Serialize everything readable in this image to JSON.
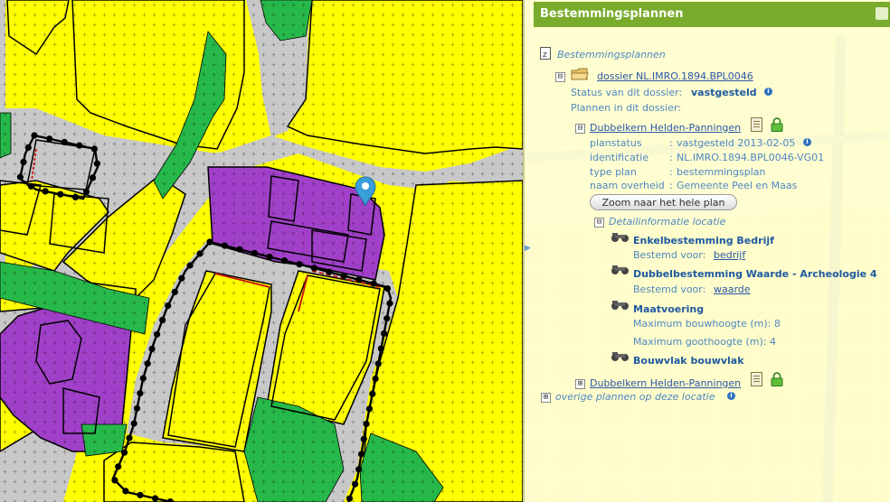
{
  "panel": {
    "title": "Bestemmingsplannen",
    "root_label": "Bestemmingsplannen",
    "dossier": {
      "link": "dossier NL.IMRO.1894.BPL0046",
      "status_label": "Status van dit dossier:",
      "status_value": "vastgesteld",
      "plans_label": "Plannen in dit dossier:"
    },
    "plan": {
      "name": "Dubbelkern Helden-Panningen",
      "rows": [
        {
          "label": "planstatus",
          "sep": ":",
          "value": "vastgesteld 2013-02-05"
        },
        {
          "label": "identificatie",
          "sep": ":",
          "value": "NL.IMRO.1894.BPL0046-VG01"
        },
        {
          "label": "type plan",
          "sep": ":",
          "value": "bestemmingsplan"
        },
        {
          "label": "naam overheid",
          "sep": ":",
          "value": "Gemeente Peel en Maas"
        }
      ],
      "zoom_button": "Zoom naar het hele plan",
      "detail_label": "Detailinformatie locatie"
    },
    "details": [
      {
        "title": "Enkelbestemming Bedrijf",
        "line1_label": "Bestemd voor:",
        "line1_link": "bedrijf"
      },
      {
        "title": "Dubbelbestemming Waarde - Archeologie 4",
        "line1_label": "Bestemd voor:",
        "line1_link": "waarde"
      },
      {
        "title": "Maatvoering",
        "line1_label": "Maximum bouwhoogte (m): 8",
        "line2_label": "Maximum goothoogte (m): 4"
      },
      {
        "title": "Bouwvlak bouwvlak"
      }
    ],
    "plan2": {
      "name": "Dubbelkern Helden-Panningen"
    },
    "other_plans": "overige plannen op deze locatie",
    "toggles": {
      "minus": "⊟",
      "plus": "⊞"
    },
    "info_glyph": "i"
  },
  "icons": [
    "doc-icon",
    "folder-icon",
    "info-icon",
    "book-icon",
    "lock-icon",
    "binoculars-icon",
    "map-marker-icon"
  ],
  "colors": {
    "enkelbestemming": "#ffff00",
    "bedrijf": "#a040c8",
    "groen": "#27b84a",
    "verkeer": "#c8c8c8",
    "panel_header": "#79ab2c",
    "link": "#2a56a8"
  }
}
